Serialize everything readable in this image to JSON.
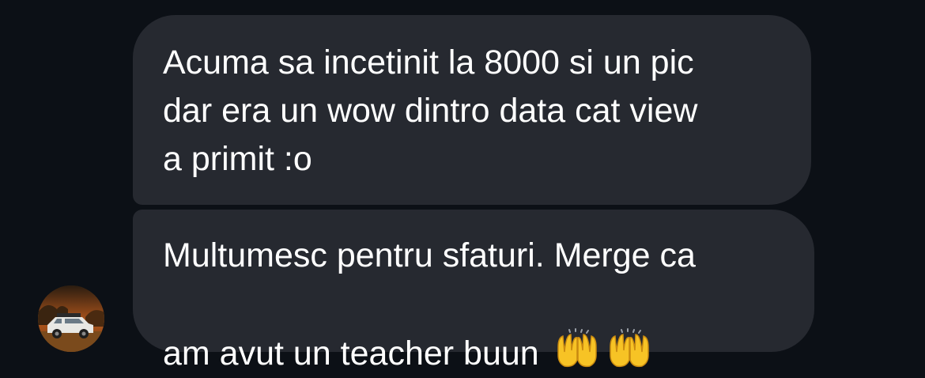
{
  "messages": [
    {
      "text": "Acuma sa incetinit la 8000 si un pic\ndar era un wow dintro data cat view\na primit :o"
    },
    {
      "text": "Multumesc pentru sfaturi. Merge ca\nam avut un teacher buun ",
      "emojis": [
        "raising-hands-icon",
        "raising-hands-icon"
      ]
    }
  ],
  "colors": {
    "background": "#0c1016",
    "bubble": "#262930",
    "text": "#ffffff",
    "emoji": "#f7c325"
  },
  "avatar": {
    "icon": "avatar-photo"
  }
}
